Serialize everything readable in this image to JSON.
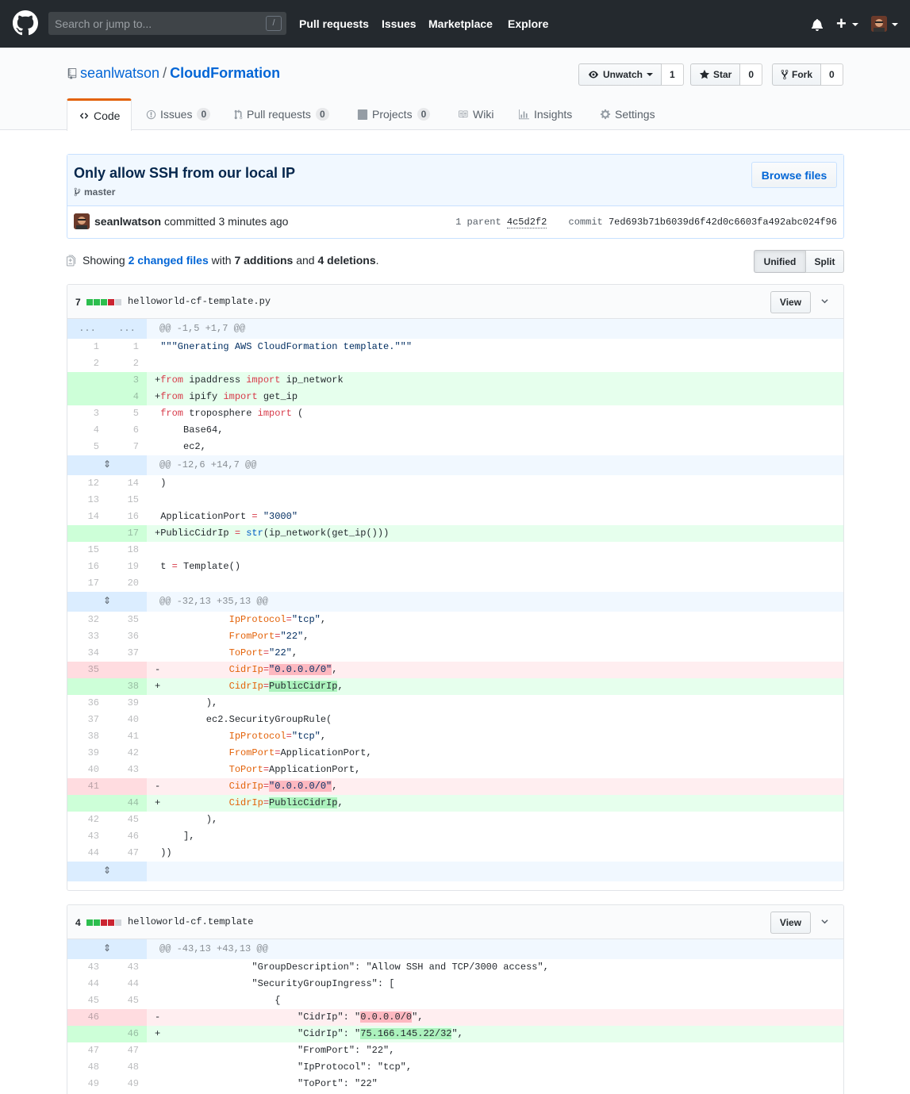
{
  "header": {
    "search_placeholder": "Search or jump to...",
    "slash_key": "/",
    "nav": [
      "Pull requests",
      "Issues",
      "Marketplace",
      "Explore"
    ]
  },
  "repo": {
    "owner": "seanlwatson",
    "sep": "/",
    "name": "CloudFormation",
    "watch_label": "Unwatch",
    "watch_count": "1",
    "star_label": "Star",
    "star_count": "0",
    "fork_label": "Fork",
    "fork_count": "0",
    "tabs": [
      {
        "label": "Code",
        "count": ""
      },
      {
        "label": "Issues",
        "count": "0"
      },
      {
        "label": "Pull requests",
        "count": "0"
      },
      {
        "label": "Projects",
        "count": "0"
      },
      {
        "label": "Wiki",
        "count": ""
      },
      {
        "label": "Insights",
        "count": ""
      },
      {
        "label": "Settings",
        "count": ""
      }
    ]
  },
  "commit": {
    "title": "Only allow SSH from our local IP",
    "branch": "master",
    "browse_label": "Browse files",
    "author": "seanlwatson",
    "action": "committed 3 minutes ago",
    "parent_label": "1 parent",
    "parent_sha": "4c5d2f2",
    "commit_label": "commit",
    "commit_sha": "7ed693b71b6039d6f42d0c6603fa492abc024f96"
  },
  "toc": {
    "showing": "Showing",
    "changed": "2 changed files",
    "with": "with",
    "additions": "7 additions",
    "and": "and",
    "deletions": "4 deletions",
    "period": ".",
    "unified": "Unified",
    "split": "Split"
  },
  "files": [
    {
      "count": "7",
      "name": "helloworld-cf-template.py",
      "view_label": "View",
      "hunks": [
        "@@ -1,5 +1,7 @@",
        "@@ -12,6 +14,7 @@",
        "@@ -32,13 +35,13 @@"
      ]
    },
    {
      "count": "4",
      "name": "helloworld-cf.template",
      "view_label": "View",
      "hunks": [
        "@@ -43,13 +43,13 @@"
      ]
    }
  ],
  "colors": {
    "header_bg": "#24292e",
    "link": "#0366d6",
    "add_bg": "#e6ffed",
    "del_bg": "#ffeef0",
    "hunk_bg": "#f1f8ff",
    "tab_accent": "#e36209"
  }
}
